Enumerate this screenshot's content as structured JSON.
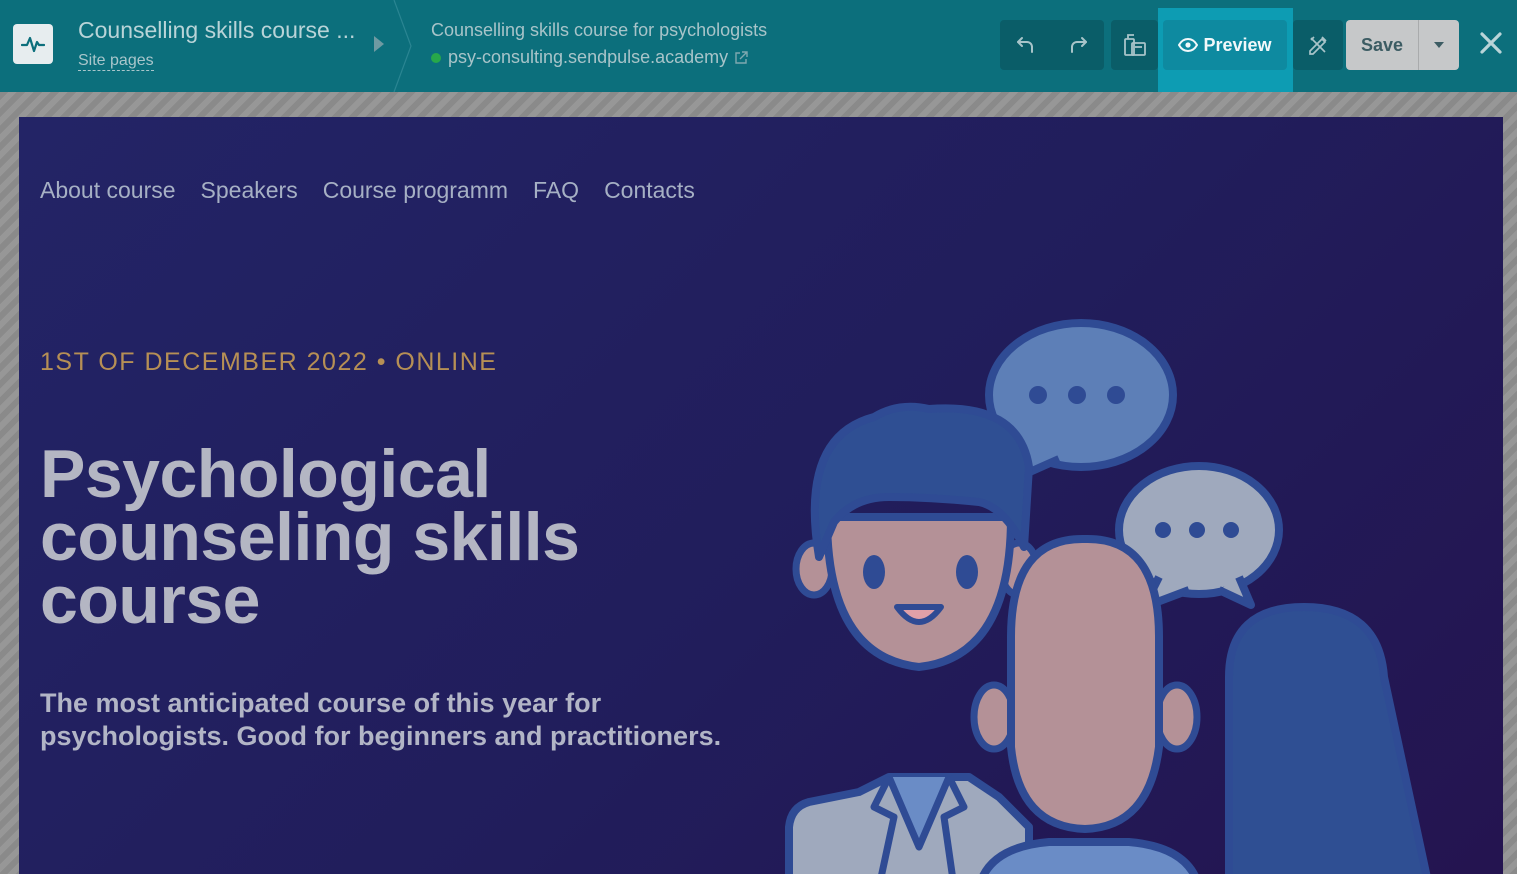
{
  "header": {
    "site_title": "Counselling skills course ...",
    "site_pages_link": "Site pages",
    "page_title": "Counselling skills course for psychologists",
    "page_url": "psy-consulting.sendpulse.academy",
    "status_color": "#27a84a",
    "toolbar": {
      "undo_icon": "undo-icon",
      "redo_icon": "redo-icon",
      "layers_icon": "page-layers-icon",
      "preview_label": "Preview",
      "design_icon": "design-tools-icon",
      "save_label": "Save",
      "close_icon": "close-icon"
    }
  },
  "page": {
    "nav": [
      "About course",
      "Speakers",
      "Course programm",
      "FAQ",
      "Contacts"
    ],
    "eyebrow": "1ST OF DECEMBER 2022 • ONLINE",
    "headline": "Psychological counseling skills course",
    "lead": "The most anticipated course of this year for psychologists. Good for beginners and practitioners."
  },
  "colors": {
    "topbar": "#0c6f7c",
    "accent": "#0e8aa0",
    "hero_bg": "#221f5e",
    "eyebrow": "#b68f55"
  }
}
